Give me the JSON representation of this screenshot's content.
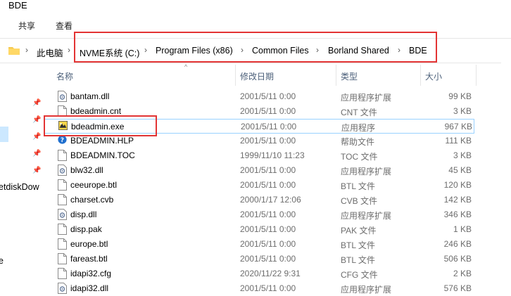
{
  "window": {
    "title": "BDE"
  },
  "ribbon": {
    "share": "共享",
    "view": "查看"
  },
  "breadcrumb": [
    "此电脑",
    "NVME系统 (C:)",
    "Program Files (x86)",
    "Common Files",
    "Borland Shared",
    "BDE"
  ],
  "nav": {
    "partial_label": "etdiskDow",
    "partial_label2": "e"
  },
  "columns": {
    "name": "名称",
    "date": "修改日期",
    "type": "类型",
    "size": "大小"
  },
  "files": [
    {
      "name": "bantam.dll",
      "date": "2001/5/11 0:00",
      "type": "应用程序扩展",
      "size": "99 KB",
      "icon": "dll-icon"
    },
    {
      "name": "bdeadmin.cnt",
      "date": "2001/5/11 0:00",
      "type": "CNT 文件",
      "size": "3 KB",
      "icon": "file-icon"
    },
    {
      "name": "bdeadmin.exe",
      "date": "2001/5/11 0:00",
      "type": "应用程序",
      "size": "967 KB",
      "icon": "exe-icon"
    },
    {
      "name": "BDEADMIN.HLP",
      "date": "2001/5/11 0:00",
      "type": "帮助文件",
      "size": "111 KB",
      "icon": "help-icon"
    },
    {
      "name": "BDEADMIN.TOC",
      "date": "1999/11/10 11:23",
      "type": "TOC 文件",
      "size": "3 KB",
      "icon": "file-icon"
    },
    {
      "name": "blw32.dll",
      "date": "2001/5/11 0:00",
      "type": "应用程序扩展",
      "size": "45 KB",
      "icon": "dll-icon"
    },
    {
      "name": "ceeurope.btl",
      "date": "2001/5/11 0:00",
      "type": "BTL 文件",
      "size": "120 KB",
      "icon": "file-icon"
    },
    {
      "name": "charset.cvb",
      "date": "2000/1/17 12:06",
      "type": "CVB 文件",
      "size": "142 KB",
      "icon": "file-icon"
    },
    {
      "name": "disp.dll",
      "date": "2001/5/11 0:00",
      "type": "应用程序扩展",
      "size": "346 KB",
      "icon": "dll-icon"
    },
    {
      "name": "disp.pak",
      "date": "2001/5/11 0:00",
      "type": "PAK 文件",
      "size": "1 KB",
      "icon": "file-icon"
    },
    {
      "name": "europe.btl",
      "date": "2001/5/11 0:00",
      "type": "BTL 文件",
      "size": "246 KB",
      "icon": "file-icon"
    },
    {
      "name": "fareast.btl",
      "date": "2001/5/11 0:00",
      "type": "BTL 文件",
      "size": "506 KB",
      "icon": "file-icon"
    },
    {
      "name": "idapi32.cfg",
      "date": "2020/11/22 9:31",
      "type": "CFG 文件",
      "size": "2 KB",
      "icon": "file-icon"
    },
    {
      "name": "idapi32.dll",
      "date": "2001/5/11 0:00",
      "type": "应用程序扩展",
      "size": "576 KB",
      "icon": "dll-icon"
    }
  ],
  "colors": {
    "highlight_box": "#e33434",
    "selection_border": "#99d1ff",
    "header_text": "#4c607a"
  }
}
